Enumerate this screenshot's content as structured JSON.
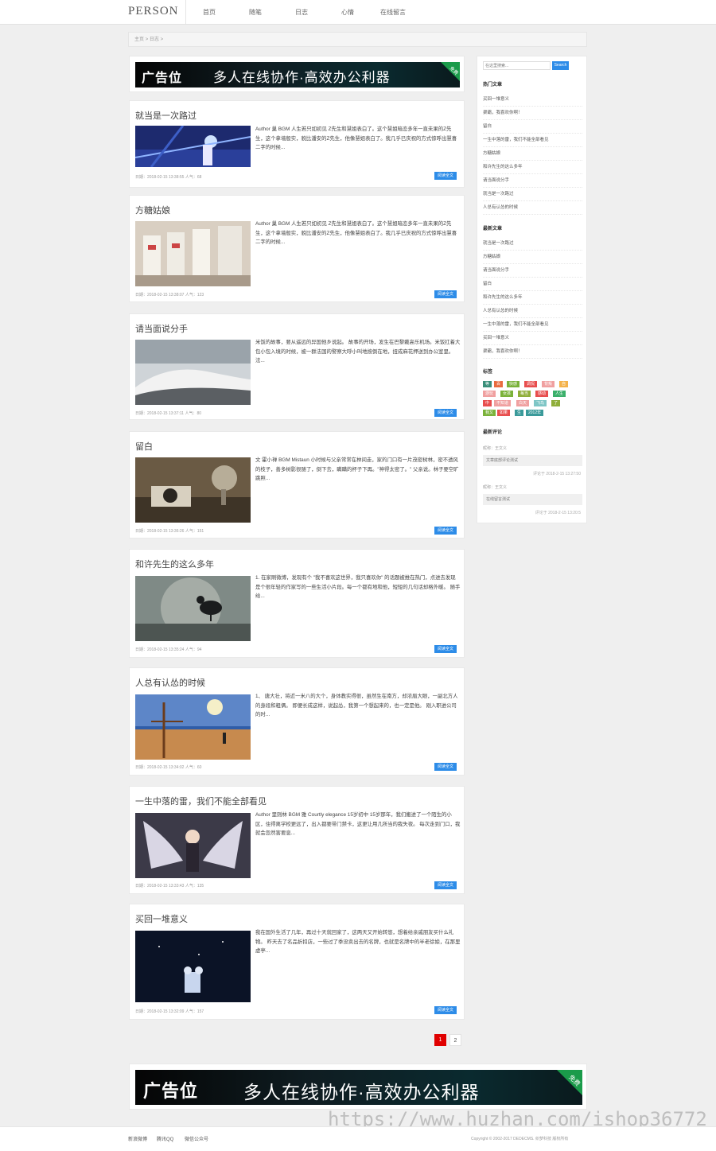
{
  "header": {
    "logo": "PERSON",
    "nav": [
      "首页",
      "随笔",
      "日志",
      "心情",
      "在线留言"
    ]
  },
  "breadcrumb": {
    "home": "主页",
    "sep": ">",
    "current": "日志",
    "trail": ">"
  },
  "ads": {
    "label": "广告位",
    "slogan": "多人在线协作·高效办公利器",
    "corner": "免费"
  },
  "posts": [
    {
      "title": "就当是一次路过",
      "excerpt": "Author 巢 BGM 人生若只如初见 Z先生和慧姐表白了。这个慧姐暗恋多年一直未果的Z先生，这个拿墙般实，貌比潘安的Z先生，他像慧姐表白了。我几乎已庆祝的方式惊呼出慧喜二字的时候...",
      "meta": "日期：2018-02-15 13:38:55  人气：68",
      "button": "阅读全文"
    },
    {
      "title": "方糖姑娘",
      "excerpt": "Author 巢 BGM 人生若只如初见 Z先生和慧姐表白了。这个慧姐暗恋多年一直未果的Z先生，这个拿墙般实，貌比潘安的Z先生，他像慧姐表白了。我几乎已庆祝的方式惊呼出慧喜二字的时候...",
      "meta": "日期：2018-02-15 13:38:07  人气：123",
      "button": "阅读全文"
    },
    {
      "title": "请当面说分手",
      "excerpt": "米饭的故事，要从遥远的异国他乡说起。 故事的开场，发生在巴黎戴高乐机场。米饭扛着大包小包入境的时候，被一群法国的警察大呼小叫地按倒在地，扭成麻花押送到办公室里。 法...",
      "meta": "日期：2018-02-15 13:37:11  人气：80",
      "button": "阅读全文"
    },
    {
      "title": "留白",
      "excerpt": "文 霍小禅 BGM Mistaun 小时候与父亲常常在林间走，家的门口有一片茂密树林，密不透风的枝子，善多树影很随了，倒下去，瞒瞒的杯子下再。\"神得太密了。\" 父亲说。林子要空旷跳照...",
      "meta": "日期：2018-02-15 13:36:26  人气：151",
      "button": "阅读全文"
    },
    {
      "title": "和许先生的这么多年",
      "excerpt": "1. 在家刷微博，发现有个 \"我不喜欢这世界，我只喜欢你\" 的话题被推在热门，点进去发现是个很年轻的作家写的一些生活小片段。每一个都有地和他，短短的几句话却格外暖。 随手给...",
      "meta": "日期：2018-02-15 13:35:24  人气：94",
      "button": "阅读全文"
    },
    {
      "title": "人总有认怂的时候",
      "excerpt": "1、 唐大壮，将近一米八的大个，身体教实得很，虽然生在南方，却浓眉大眼，一副北方人的身段和粗俩。 即便长成这样，说起怂，我第一个想起来的，也一定是他。 刚入职进公司的时...",
      "meta": "日期：2018-02-15 13:34:02  人气：60",
      "button": "阅读全文"
    },
    {
      "title": "一生中落的雷，我们不能全部看见",
      "excerpt": "Author 里则林 BGM 雅 Courtly elegance 15岁初中 15岁那年，我们搬进了一个陌生的小区，住得离学校更远了，出入都要带门禁卡，这更让用几所当的我失夜。 每次走到门口，我就会忽然害要息...",
      "meta": "日期：2018-02-15 13:33:43  人气：135",
      "button": "阅读全文"
    },
    {
      "title": "买回一堆意义",
      "excerpt": "我在国外生活了几年，再过十天就回家了，这两天又开始转悠，想着给亲戚朋友买什么礼物。 昨天去了名品折扣店，一些过了季没卖出去的名牌，也就是名牌中的半老徐娘，在那里虚亭...",
      "meta": "日期：2018-02-15 13:32:09  人气：157",
      "button": "阅读全文"
    }
  ],
  "sidebar": {
    "search_placeholder": "在这里搜索...",
    "search_button": "Search",
    "hot_title": "热门文章",
    "hot": [
      "买回一堆意义",
      "渠霸，我喜欢你啊！",
      "留白",
      "一生中落的雷，我们不能全部看见",
      "方糖姑娘",
      "和许先生的这么多年",
      "请当面说分手",
      "就当是一次路过",
      "人总有认怂的时候"
    ],
    "recent_title": "最新文章",
    "recent": [
      "就当是一次路过",
      "方糖姑娘",
      "请当面说分手",
      "留白",
      "和许先生的这么多年",
      "人总有认怂的时候",
      "一生中落的雷，我们不能全部看见",
      "买回一堆意义",
      "渠霸，我喜欢你啊！"
    ],
    "tags_title": "标签",
    "tags": [
      {
        "text": "等",
        "color": "#3a8f7a"
      },
      {
        "text": "百",
        "color": "#e96c3f"
      },
      {
        "text": "快感",
        "color": "#7ab23a"
      },
      {
        "text": "调侃",
        "color": "#e84e4e"
      },
      {
        "text": "背叛",
        "color": "#f0a0a0"
      },
      {
        "text": "自",
        "color": "#f4b24a"
      },
      {
        "text": "游玩",
        "color": "#f0a0a0"
      },
      {
        "text": "女孩",
        "color": "#7ab23a"
      },
      {
        "text": "每当",
        "color": "#8fae3a"
      },
      {
        "text": "感动",
        "color": "#e84e4e"
      },
      {
        "text": "人生",
        "color": "#3aaf6a"
      },
      {
        "text": "中",
        "color": "#e84e4e"
      },
      {
        "text": "不知道",
        "color": "#f0a0a0"
      },
      {
        "text": "白天",
        "color": "#f0a0a0"
      },
      {
        "text": "飞鸟",
        "color": "#7fc6c6"
      },
      {
        "text": "了",
        "color": "#8fae3a"
      },
      {
        "text": "我又",
        "color": "#7ab23a"
      },
      {
        "text": "如果",
        "color": "#e84e4e"
      },
      {
        "text": "生",
        "color": "#3a9a9a"
      },
      {
        "text": "2012年",
        "color": "#3a9a9a"
      }
    ],
    "comments_title": "最新评论",
    "comments": [
      {
        "user": "昵称：王文义",
        "body": "文章底部评论测试",
        "time": "评论于 2018-2-15 13:27:50"
      },
      {
        "user": "昵称：王文义",
        "body": "在线留言测试",
        "time": "评论于 2018-2-15 13:20:5"
      }
    ]
  },
  "pagination": {
    "current": "1",
    "next": "2"
  },
  "footer": {
    "links": [
      "新浪微博",
      "腾讯QQ",
      "微信公众号"
    ],
    "copyright": "Copyright © 2002-2017 DEDECMS. 织梦科技 版权所有"
  },
  "watermark": "https://www.huzhan.com/ishop36772"
}
